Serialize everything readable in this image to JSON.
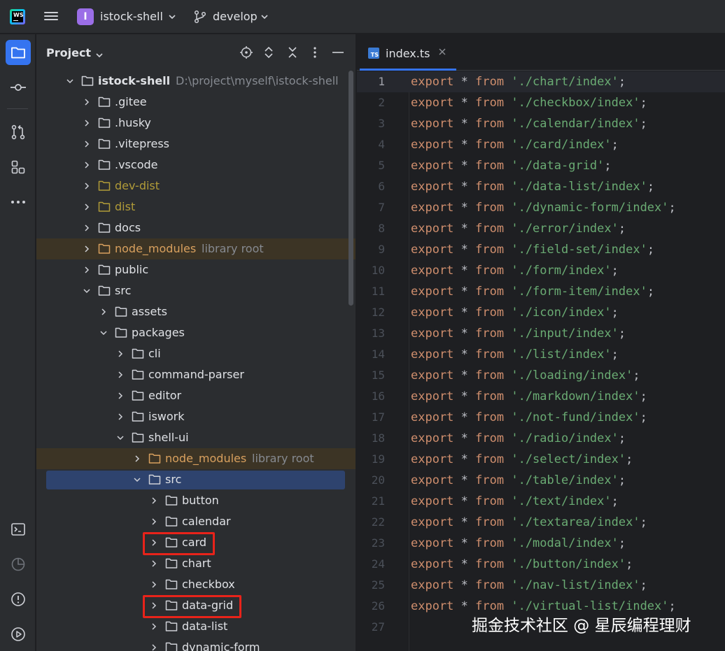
{
  "titlebar": {
    "logo_text": "WS",
    "project_badge": "I",
    "project_name": "istock-shell",
    "branch_name": "develop"
  },
  "sidebar_tools": [
    {
      "name": "project-tool",
      "icon": "folder-icon",
      "active": true
    },
    {
      "name": "commit-tool",
      "icon": "commit-icon",
      "active": false
    },
    {
      "name": "pull-requests-tool",
      "icon": "pull-request-icon",
      "active": false
    },
    {
      "name": "structure-tool",
      "icon": "structure-icon",
      "active": false
    },
    {
      "name": "more-tools",
      "icon": "more-icon",
      "active": false
    },
    {
      "name": "terminal-tool",
      "icon": "terminal-icon",
      "active": false
    },
    {
      "name": "profiler-tool",
      "icon": "profiler-icon",
      "active": false
    },
    {
      "name": "problems-tool",
      "icon": "problems-icon",
      "active": false
    },
    {
      "name": "services-tool",
      "icon": "services-icon",
      "active": false
    }
  ],
  "project_panel": {
    "title": "Project",
    "tree": [
      {
        "label": "istock-shell",
        "hint": "D:\\project\\myself\\istock-shell",
        "depth": 0,
        "expanded": true,
        "style": "bold"
      },
      {
        "label": ".gitee",
        "depth": 1,
        "expanded": false
      },
      {
        "label": ".husky",
        "depth": 1,
        "expanded": false
      },
      {
        "label": ".vitepress",
        "depth": 1,
        "expanded": false
      },
      {
        "label": ".vscode",
        "depth": 1,
        "expanded": false
      },
      {
        "label": "dev-dist",
        "depth": 1,
        "expanded": false,
        "style": "excluded"
      },
      {
        "label": "dist",
        "depth": 1,
        "expanded": false,
        "style": "excluded"
      },
      {
        "label": "docs",
        "depth": 1,
        "expanded": false
      },
      {
        "label": "node_modules",
        "hint": "library root",
        "depth": 1,
        "expanded": false,
        "style": "nm"
      },
      {
        "label": "public",
        "depth": 1,
        "expanded": false
      },
      {
        "label": "src",
        "depth": 1,
        "expanded": true
      },
      {
        "label": "assets",
        "depth": 2,
        "expanded": false
      },
      {
        "label": "packages",
        "depth": 2,
        "expanded": true
      },
      {
        "label": "cli",
        "depth": 3,
        "expanded": false
      },
      {
        "label": "command-parser",
        "depth": 3,
        "expanded": false
      },
      {
        "label": "editor",
        "depth": 3,
        "expanded": false
      },
      {
        "label": "iswork",
        "depth": 3,
        "expanded": false
      },
      {
        "label": "shell-ui",
        "depth": 3,
        "expanded": true
      },
      {
        "label": "node_modules",
        "hint": "library root",
        "depth": 4,
        "expanded": false,
        "style": "nm"
      },
      {
        "label": "src",
        "depth": 4,
        "expanded": true,
        "selected": true
      },
      {
        "label": "button",
        "depth": 5,
        "expanded": false
      },
      {
        "label": "calendar",
        "depth": 5,
        "expanded": false
      },
      {
        "label": "card",
        "depth": 5,
        "expanded": false,
        "highlighted": true
      },
      {
        "label": "chart",
        "depth": 5,
        "expanded": false
      },
      {
        "label": "checkbox",
        "depth": 5,
        "expanded": false
      },
      {
        "label": "data-grid",
        "depth": 5,
        "expanded": false,
        "highlighted": true
      },
      {
        "label": "data-list",
        "depth": 5,
        "expanded": false
      },
      {
        "label": "dynamic-form",
        "depth": 5,
        "expanded": false
      }
    ]
  },
  "editor": {
    "tab_label": "index.ts",
    "tab_icon_text": "TS",
    "current_line": 1,
    "lines": [
      {
        "n": "1",
        "kw": "export",
        "op": " * ",
        "from": "from",
        "path": "'./chart/index'"
      },
      {
        "n": "2",
        "kw": "export",
        "op": " * ",
        "from": "from",
        "path": "'./checkbox/index'"
      },
      {
        "n": "3",
        "kw": "export",
        "op": " * ",
        "from": "from",
        "path": "'./calendar/index'"
      },
      {
        "n": "4",
        "kw": "export",
        "op": " * ",
        "from": "from",
        "path": "'./card/index'"
      },
      {
        "n": "5",
        "kw": "export",
        "op": " * ",
        "from": "from",
        "path": "'./data-grid'"
      },
      {
        "n": "6",
        "kw": "export",
        "op": " * ",
        "from": "from",
        "path": "'./data-list/index'"
      },
      {
        "n": "7",
        "kw": "export",
        "op": " * ",
        "from": "from",
        "path": "'./dynamic-form/index'"
      },
      {
        "n": "8",
        "kw": "export",
        "op": " * ",
        "from": "from",
        "path": "'./error/index'"
      },
      {
        "n": "9",
        "kw": "export",
        "op": " * ",
        "from": "from",
        "path": "'./field-set/index'"
      },
      {
        "n": "10",
        "kw": "export",
        "op": " * ",
        "from": "from",
        "path": "'./form/index'"
      },
      {
        "n": "11",
        "kw": "export",
        "op": " * ",
        "from": "from",
        "path": "'./form-item/index'"
      },
      {
        "n": "12",
        "kw": "export",
        "op": " * ",
        "from": "from",
        "path": "'./icon/index'"
      },
      {
        "n": "13",
        "kw": "export",
        "op": " * ",
        "from": "from",
        "path": "'./input/index'"
      },
      {
        "n": "14",
        "kw": "export",
        "op": " * ",
        "from": "from",
        "path": "'./list/index'"
      },
      {
        "n": "15",
        "kw": "export",
        "op": " * ",
        "from": "from",
        "path": "'./loading/index'"
      },
      {
        "n": "16",
        "kw": "export",
        "op": " * ",
        "from": "from",
        "path": "'./markdown/index'"
      },
      {
        "n": "17",
        "kw": "export",
        "op": " * ",
        "from": "from",
        "path": "'./not-fund/index'"
      },
      {
        "n": "18",
        "kw": "export",
        "op": " * ",
        "from": "from",
        "path": "'./radio/index'"
      },
      {
        "n": "19",
        "kw": "export",
        "op": " * ",
        "from": "from",
        "path": "'./select/index'"
      },
      {
        "n": "20",
        "kw": "export",
        "op": " * ",
        "from": "from",
        "path": "'./table/index'"
      },
      {
        "n": "21",
        "kw": "export",
        "op": " * ",
        "from": "from",
        "path": "'./text/index'"
      },
      {
        "n": "22",
        "kw": "export",
        "op": " * ",
        "from": "from",
        "path": "'./textarea/index'"
      },
      {
        "n": "23",
        "kw": "export",
        "op": " * ",
        "from": "from",
        "path": "'./modal/index'"
      },
      {
        "n": "24",
        "kw": "export",
        "op": " * ",
        "from": "from",
        "path": "'./button/index'"
      },
      {
        "n": "25",
        "kw": "export",
        "op": " * ",
        "from": "from",
        "path": "'./nav-list/index'"
      },
      {
        "n": "26",
        "kw": "export",
        "op": " * ",
        "from": "from",
        "path": "'./virtual-list/index'"
      },
      {
        "n": "27",
        "kw": "",
        "op": "",
        "from": "",
        "path": ""
      }
    ]
  },
  "watermark": "掘金技术社区 @ 星辰编程理财",
  "colors": {
    "accent": "#3574f0",
    "keyword": "#cf8e6d",
    "string": "#6aab73",
    "highlight_box": "#e8231a",
    "project_badge": "#9b6ee7"
  }
}
